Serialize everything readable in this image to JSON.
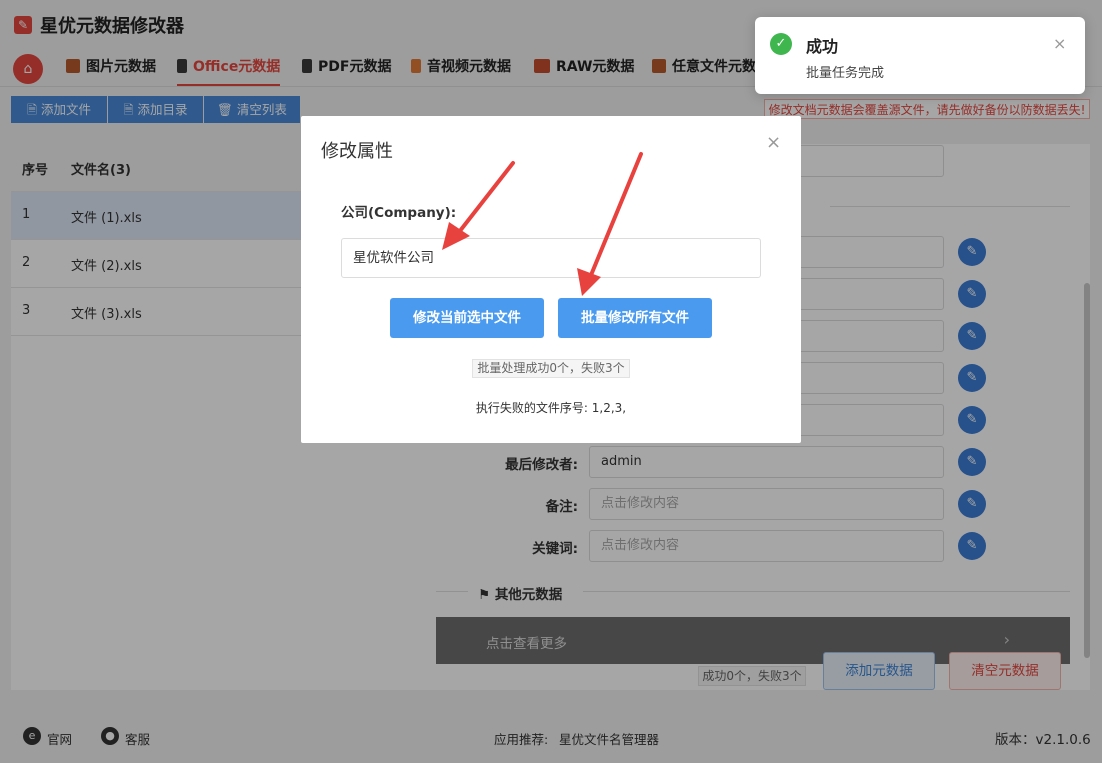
{
  "app": {
    "title": "星优元数据修改器",
    "logo_icon": "app-logo-icon"
  },
  "nav": {
    "tabs": [
      {
        "label": "图片元数据",
        "color": "#b95a2b"
      },
      {
        "label": "Office元数据",
        "color": "#3a3a3a"
      },
      {
        "label": "PDF元数据",
        "color": "#3a3a3a"
      },
      {
        "label": "音视频元数据",
        "color": "#e07a38"
      },
      {
        "label": "RAW元数据",
        "color": "#c64d2e"
      },
      {
        "label": "任意文件元数",
        "color": "#b95a2b"
      }
    ],
    "active_tab": "Office元数据"
  },
  "toolbar": {
    "add_file": "添加文件",
    "add_dir": "添加目录",
    "clear_list": "清空列表"
  },
  "warning": "修改文档元数据会覆盖源文件，请先做好备份以防数据丢失!",
  "file_table": {
    "headers": {
      "no": "序号",
      "name": "文件名(3)"
    },
    "rows": [
      {
        "no": "1",
        "name": "文件 (1).xls"
      },
      {
        "no": "2",
        "name": "文件 (2).xls"
      },
      {
        "no": "3",
        "name": "文件 (3).xls"
      }
    ]
  },
  "fields": {
    "last_modified_by": {
      "label": "最后修改者:",
      "value": "admin"
    },
    "comments": {
      "label": "备注:",
      "placeholder": "点击修改内容"
    },
    "keywords": {
      "label": "关键词:",
      "placeholder": "点击修改内容"
    }
  },
  "other_meta": {
    "section_title": "其他元数据",
    "view_more": "点击查看更多",
    "chevron": "›"
  },
  "bottom": {
    "count": "成功0个，失败3个",
    "add_meta": "添加元数据",
    "clear_meta": "清空元数据"
  },
  "footer": {
    "site": "官网",
    "service": "客服",
    "recommend_label": "应用推荐:",
    "recommend_app": "星优文件名管理器",
    "version": "版本：v2.1.0.6"
  },
  "dialog": {
    "title": "修改属性",
    "close": "×",
    "label": "公司(Company):",
    "value": "星优软件公司",
    "btn_current": "修改当前选中文件",
    "btn_all": "批量修改所有文件",
    "status": "批量处理成功0个，失败3个",
    "fail_text": "执行失败的文件序号: 1,2,3,"
  },
  "toast": {
    "title": "成功",
    "message": "批量任务完成",
    "close": "×"
  },
  "colors": {
    "accent": "#e5483f",
    "primary": "#4a9bf0",
    "success": "#3fb64e",
    "arrow": "#e8423f"
  }
}
